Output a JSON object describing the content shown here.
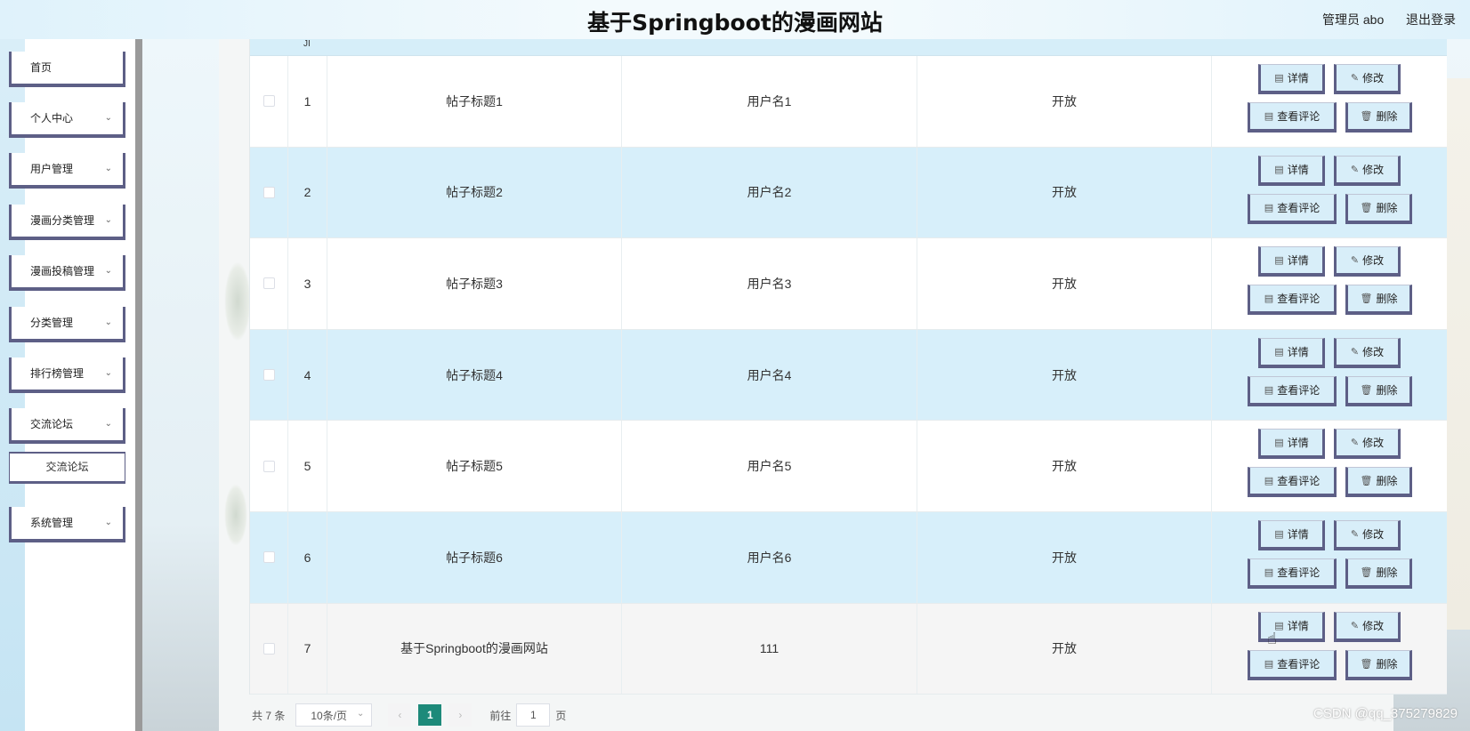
{
  "header": {
    "title": "基于Springboot的漫画网站",
    "user": "管理员 abo",
    "logout": "退出登录"
  },
  "sidebar": {
    "items": [
      {
        "label": "首页"
      },
      {
        "label": "个人中心"
      },
      {
        "label": "用户管理"
      },
      {
        "label": "漫画分类管理"
      },
      {
        "label": "漫画投稿管理"
      },
      {
        "label": "分类管理"
      },
      {
        "label": "排行榜管理"
      },
      {
        "label": "交流论坛"
      },
      {
        "label": "系统管理"
      }
    ],
    "submenu": {
      "label": "交流论坛"
    }
  },
  "table": {
    "header_fragment": "JI",
    "rows": [
      {
        "idx": "1",
        "title": "帖子标题1",
        "user": "用户名1",
        "status": "开放"
      },
      {
        "idx": "2",
        "title": "帖子标题2",
        "user": "用户名2",
        "status": "开放"
      },
      {
        "idx": "3",
        "title": "帖子标题3",
        "user": "用户名3",
        "status": "开放"
      },
      {
        "idx": "4",
        "title": "帖子标题4",
        "user": "用户名4",
        "status": "开放"
      },
      {
        "idx": "5",
        "title": "帖子标题5",
        "user": "用户名5",
        "status": "开放"
      },
      {
        "idx": "6",
        "title": "帖子标题6",
        "user": "用户名6",
        "status": "开放"
      },
      {
        "idx": "7",
        "title": "基于Springboot的漫画网站",
        "user": "111",
        "status": "开放"
      }
    ],
    "actions": {
      "detail": "详情",
      "edit": "修改",
      "comments": "查看评论",
      "delete": "删除"
    }
  },
  "pagination": {
    "total": "共 7 条",
    "page_size": "10条/页",
    "current_page": "1",
    "goto_label": "前往",
    "goto_value": "1",
    "page_suffix": "页"
  },
  "watermark": "CSDN @qq_375279829",
  "colors": {
    "accent": "#1d8a7a",
    "button_border": "#5d5f86",
    "row_blue": "#d7effa"
  }
}
